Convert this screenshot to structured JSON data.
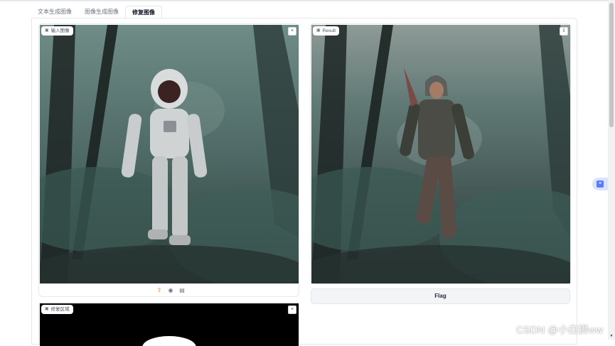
{
  "tabs": [
    {
      "label": "文本生成图像"
    },
    {
      "label": "图像生成图像"
    },
    {
      "label": "修复图像",
      "active": true
    }
  ],
  "input_panel": {
    "label": "输入图像",
    "label_icon": "image-icon",
    "close": "×"
  },
  "result_panel": {
    "label": "Result",
    "label_icon": "image-icon",
    "close": "⇩"
  },
  "mask_panel": {
    "label": "修复区域",
    "label_icon": "image-icon",
    "close": "×"
  },
  "toolbar": {
    "upload": "⇧",
    "webcam": "◉",
    "clipboard": "▤"
  },
  "flag_button": {
    "label": "Flag"
  },
  "watermark": {
    "text": "CSDN @小白狮ww"
  },
  "colors": {
    "accent": "#f97316",
    "border": "#e5e7eb",
    "float_button": "#5b7cfa"
  }
}
